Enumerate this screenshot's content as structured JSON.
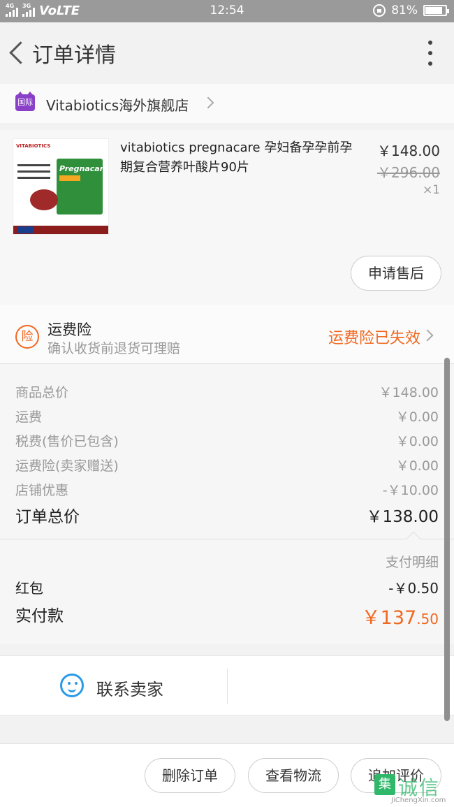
{
  "status_bar": {
    "network_left": "4G",
    "network_right": "3G",
    "carrier_tech": "VoLTE",
    "time": "12:54",
    "battery": "81%",
    "battery_level": 0.81
  },
  "header": {
    "title": "订单详情"
  },
  "shop": {
    "badge": "国际",
    "name": "Vitabiotics海外旗舰店"
  },
  "product": {
    "title": "vitabiotics pregnacare 孕妇备孕孕前孕期复合营养叶酸片90片",
    "price": "￥148.00",
    "original_price": "￥296.00",
    "quantity": "×1",
    "image_brand": "VITABIOTICS",
    "image_product": "Pregnacare",
    "after_sale_label": "申请售后"
  },
  "insurance": {
    "icon_char": "险",
    "title": "运费险",
    "subtitle": "确认收货前退货可理赔",
    "status": "运费险已失效"
  },
  "summary": {
    "rows": [
      {
        "label": "商品总价",
        "value": "￥148.00"
      },
      {
        "label": "运费",
        "value": "￥0.00"
      },
      {
        "label": "税费(售价已包含)",
        "value": "￥0.00"
      },
      {
        "label": "运费险(卖家赠送)",
        "value": "￥0.00"
      },
      {
        "label": "店铺优惠",
        "value": "-￥10.00"
      }
    ],
    "total_label": "订单总价",
    "total_value": "￥138.00"
  },
  "payment": {
    "detail_label": "支付明细",
    "redpacket_label": "红包",
    "redpacket_value": "-￥0.50",
    "paid_label": "实付款",
    "paid_int": "￥137",
    "paid_dec": ".50"
  },
  "contact": {
    "label": "联系卖家"
  },
  "actions": {
    "delete": "删除订单",
    "logistics": "查看物流",
    "review": "追加评价"
  },
  "watermark": {
    "logo": "集",
    "text": "诚信",
    "url": "JiChengXin.com"
  },
  "colors": {
    "accent": "#f06820",
    "contact_blue": "#2a9ae8",
    "intl_badge": "#8a3fc9"
  }
}
